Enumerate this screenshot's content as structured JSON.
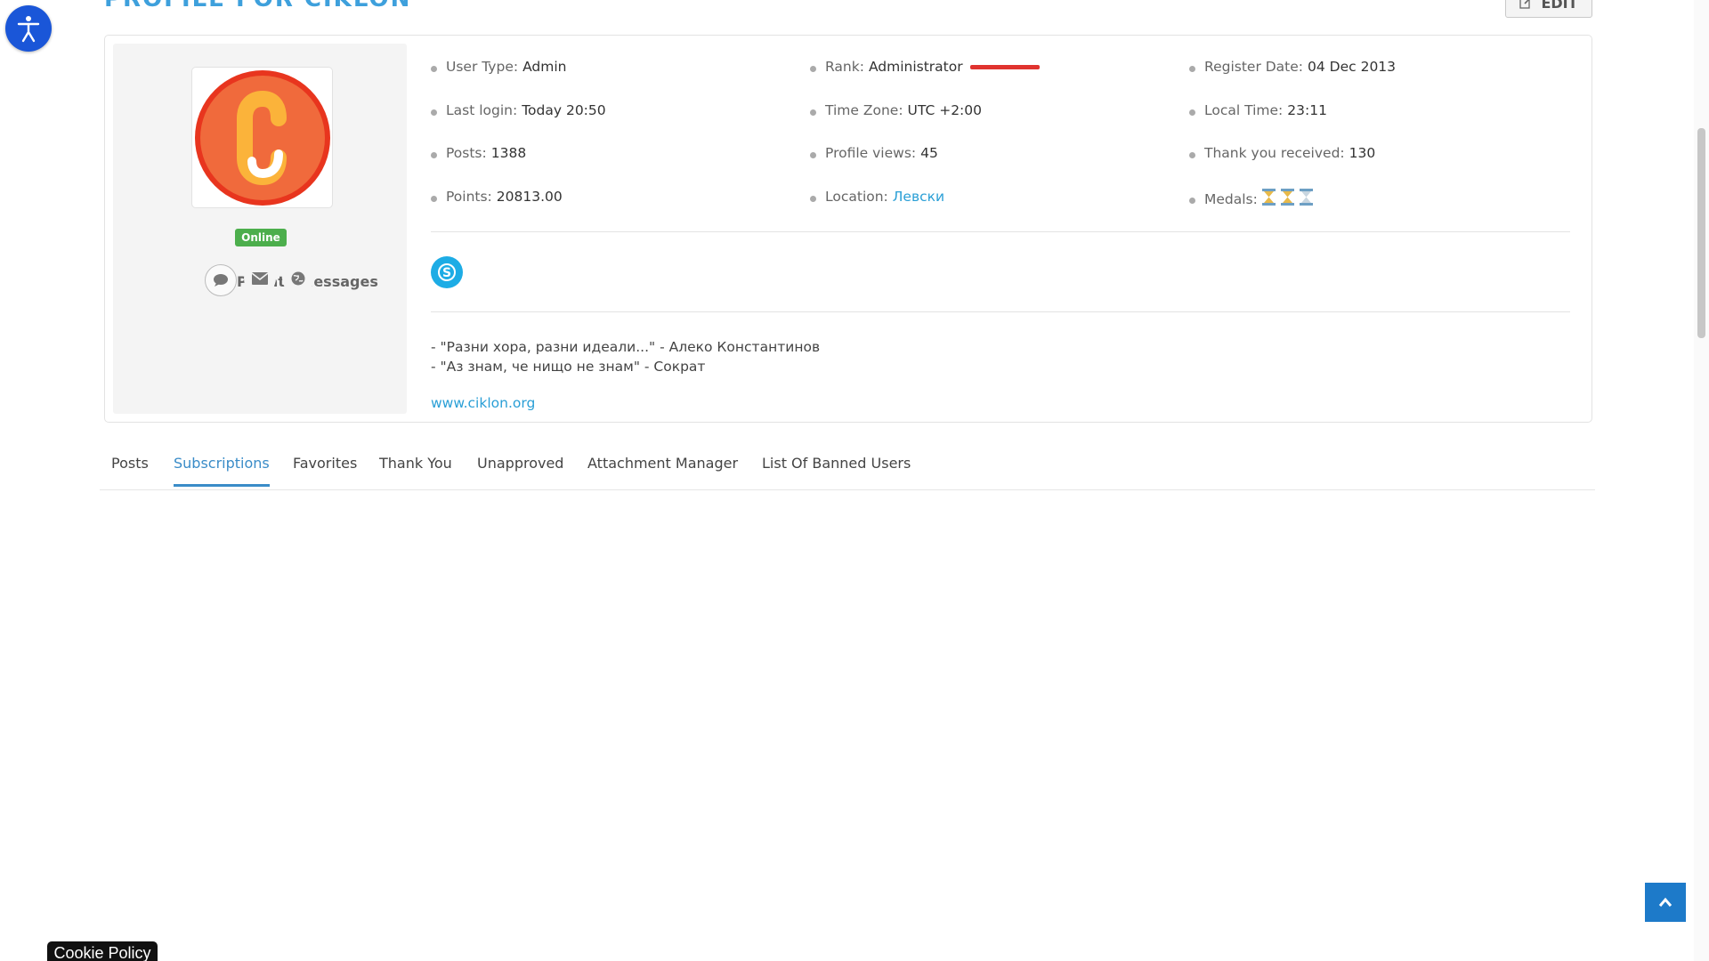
{
  "header": {
    "title": "PROFILE FOR CIKLON",
    "edit_label": "EDIT"
  },
  "profile": {
    "status": "Online",
    "contact_label": "Private Messages",
    "info": {
      "user_type": {
        "label": "User Type:",
        "value": "Admin"
      },
      "rank": {
        "label": "Rank:",
        "value": "Administrator"
      },
      "register_date": {
        "label": "Register Date:",
        "value": "04 Dec 2013"
      },
      "last_login": {
        "label": "Last login:",
        "value": "Today 20:50"
      },
      "time_zone": {
        "label": "Time Zone:",
        "value": "UTC +2:00"
      },
      "local_time": {
        "label": "Local Time:",
        "value": "23:11"
      },
      "posts": {
        "label": "Posts:",
        "value": "1388"
      },
      "profile_views": {
        "label": "Profile views:",
        "value": "45"
      },
      "thank_you_received": {
        "label": "Thank you received:",
        "value": "130"
      },
      "points": {
        "label": "Points:",
        "value": "20813.00"
      },
      "location": {
        "label": "Location:",
        "value": "Левски"
      },
      "medals": {
        "label": "Medals:",
        "value": [
          "hourglass-icon",
          "hourglass-icon",
          "hourglass-icon"
        ]
      }
    },
    "signature": {
      "line1": "- \"Разни хора, разни идеали...\" - Алеко Константинов",
      "line2": "- \"Аз знам, че нищо не знам\" - Сократ",
      "website": "www.ciklon.org"
    }
  },
  "tabs": [
    {
      "label": "Posts"
    },
    {
      "label": "Subscriptions",
      "active": true
    },
    {
      "label": "Favorites"
    },
    {
      "label": "Thank You"
    },
    {
      "label": "Unapproved"
    },
    {
      "label": "Attachment Manager"
    },
    {
      "label": "List Of Banned Users"
    }
  ],
  "footer": {
    "cookie_label": "Cookie Policy"
  },
  "colors": {
    "accent": "#3a8cc8",
    "link": "#2a9fd6",
    "online": "#4cae4c",
    "rank_bar": "#e0332f",
    "a11y": "#1a56d8"
  }
}
